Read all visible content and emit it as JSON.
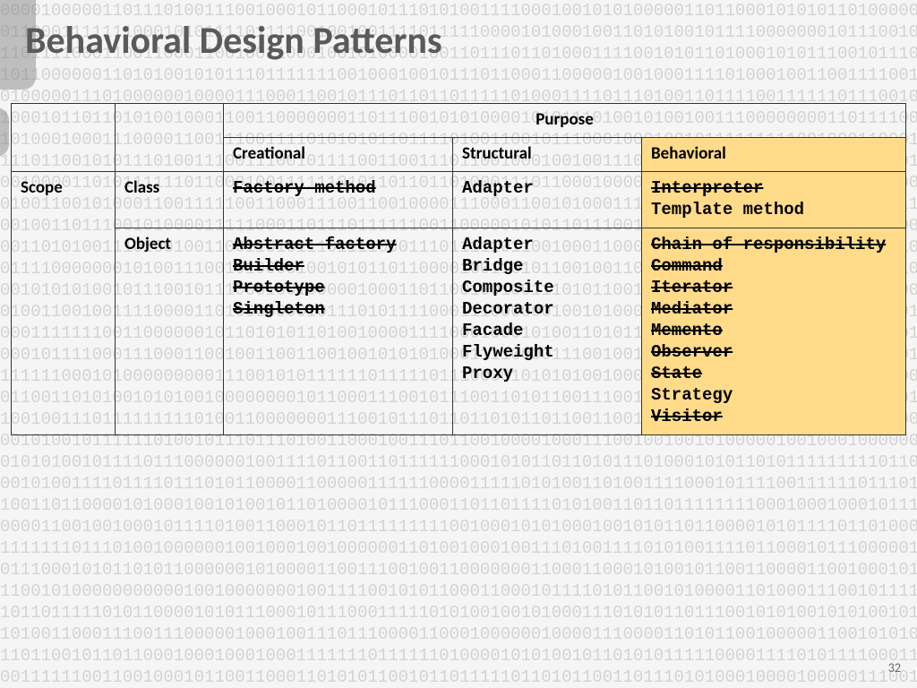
{
  "title": "Behavioral Design Patterns",
  "page_number": "32",
  "table": {
    "purpose_label": "Purpose",
    "scope_label": "Scope",
    "class_label": "Class",
    "object_label": "Object",
    "columns": {
      "creational": "Creational",
      "structural": "Structural",
      "behavioral": "Behavioral"
    },
    "rows": {
      "class": {
        "creational": [
          {
            "text": "Factory method",
            "strike": true
          }
        ],
        "structural": [
          {
            "text": "Adapter",
            "strike": false
          }
        ],
        "behavioral": [
          {
            "text": "Interpreter",
            "strike": true
          },
          {
            "text": "Template method",
            "strike": false
          }
        ]
      },
      "object": {
        "creational": [
          {
            "text": "Abstract factory",
            "strike": true
          },
          {
            "text": "Builder",
            "strike": true
          },
          {
            "text": "Prototype",
            "strike": true
          },
          {
            "text": "Singleton",
            "strike": true
          }
        ],
        "structural": [
          {
            "text": "Adapter",
            "strike": false
          },
          {
            "text": "Bridge",
            "strike": false
          },
          {
            "text": "Composite",
            "strike": false
          },
          {
            "text": "Decorator",
            "strike": false
          },
          {
            "text": "Facade",
            "strike": false
          },
          {
            "text": "Flyweight",
            "strike": false
          },
          {
            "text": "Proxy",
            "strike": false
          }
        ],
        "behavioral": [
          {
            "text": "Chain of responsibility",
            "strike": true
          },
          {
            "text": "Command",
            "strike": true
          },
          {
            "text": "Iterator",
            "strike": true
          },
          {
            "text": "Mediator",
            "strike": true
          },
          {
            "text": "Memento",
            "strike": true
          },
          {
            "text": "Observer",
            "strike": true
          },
          {
            "text": "State",
            "strike": true
          },
          {
            "text": "Strategy",
            "strike": false
          },
          {
            "text": "Visitor",
            "strike": true
          }
        ]
      }
    }
  }
}
